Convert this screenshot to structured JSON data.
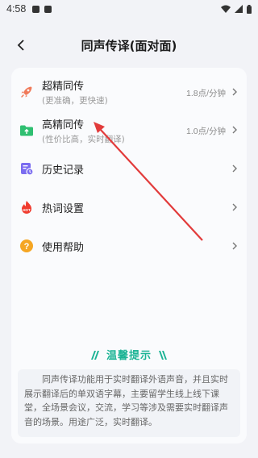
{
  "status": {
    "time": "4:58"
  },
  "header": {
    "title": "同声传译(面对面)"
  },
  "menu": [
    {
      "label": "超精同传",
      "sub": "(更准确，更快速)",
      "price": "1.8点/分钟",
      "icon": "rocket-icon",
      "color": "#f07a5a"
    },
    {
      "label": "高精同传",
      "sub": "(性价比高，实时翻译)",
      "price": "1.0点/分钟",
      "icon": "folder-upload-icon",
      "color": "#2fbf71"
    },
    {
      "label": "历史记录",
      "icon": "history-icon",
      "color": "#7a6cf0"
    },
    {
      "label": "热词设置",
      "icon": "hot-fire-icon",
      "color": "#f03b2e"
    },
    {
      "label": "使用帮助",
      "icon": "help-icon",
      "color": "#f5a623"
    }
  ],
  "tips": {
    "title": "温馨提示",
    "text": "同声传译功能用于实时翻译外语声音，并且实时展示翻译后的单双语字幕，主要留学生线上线下课堂，全场景会议，交流，学习等涉及需要实时翻译声音的场景。用途广泛，实时翻译。"
  }
}
